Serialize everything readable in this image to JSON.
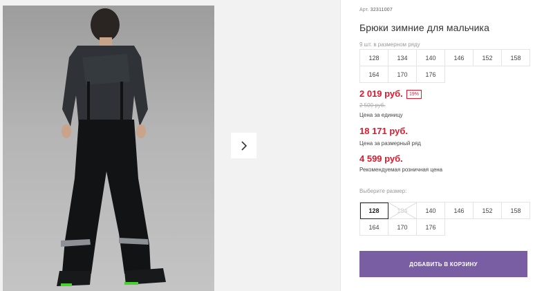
{
  "gallery": {
    "photo_alt": "boy in black winter trousers",
    "next_icon": "chevron-right-icon"
  },
  "product": {
    "art_label": "Арт.",
    "art_value": "32311007",
    "title": "Брюки зимние для мальчика",
    "row_label": "9 шт. в размерном ряду",
    "row_sizes": [
      "128",
      "134",
      "140",
      "146",
      "152",
      "158",
      "164",
      "170",
      "176"
    ]
  },
  "pricing": {
    "price": "2 019 руб.",
    "discount": "19%",
    "old_price": "2 500 руб.",
    "unit_note": "Цена за единицу",
    "row_price": "18 171 руб.",
    "row_note": "Цена за размерный ряд",
    "rrp": "4 599 руб.",
    "rrp_note": "Рекомендуемая розничная цена"
  },
  "size_select": {
    "label": "Выберите размер:",
    "sizes": [
      {
        "value": "128",
        "state": "selected"
      },
      {
        "value": "134",
        "state": "disabled"
      },
      {
        "value": "140",
        "state": "available"
      },
      {
        "value": "146",
        "state": "available"
      },
      {
        "value": "152",
        "state": "available"
      },
      {
        "value": "158",
        "state": "available"
      },
      {
        "value": "164",
        "state": "available"
      },
      {
        "value": "170",
        "state": "available"
      },
      {
        "value": "176",
        "state": "available"
      }
    ]
  },
  "cart": {
    "button_label": "ДОБАВИТЬ В КОРЗИНУ",
    "button_color": "#7a5ea3"
  },
  "colors": {
    "price_red": "#e0182d"
  }
}
